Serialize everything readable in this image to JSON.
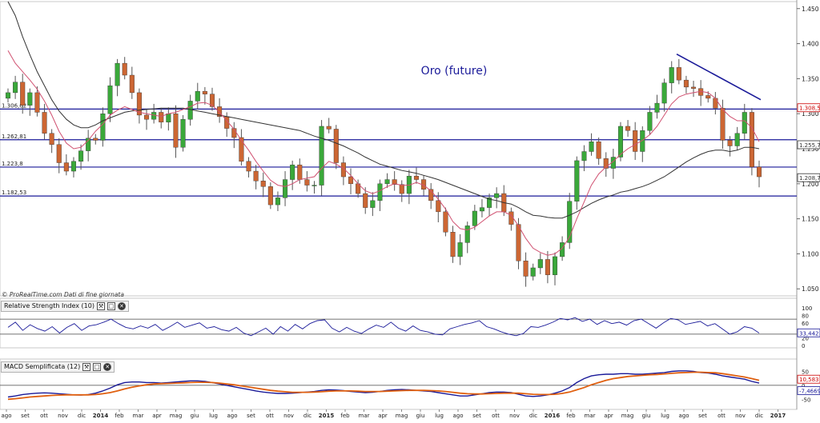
{
  "chart_data": [
    {
      "type": "candlestick",
      "title": "Oro (future)",
      "ylim": [
        1040,
        1460
      ],
      "y_ticks": [
        "1.450",
        "1.400",
        "1.350",
        "1.300",
        "1.250",
        "1.200",
        "1.150",
        "1.100",
        "1.050"
      ],
      "x_labels": [
        "ago",
        "set",
        "ott",
        "nov",
        "dic",
        "2014",
        "feb",
        "mar",
        "apr",
        "mag",
        "giu",
        "lug",
        "ago",
        "set",
        "ott",
        "nov",
        "dic",
        "2015",
        "feb",
        "mar",
        "apr",
        "mag",
        "giu",
        "lug",
        "ago",
        "set",
        "ott",
        "nov",
        "dic",
        "2016",
        "feb",
        "mar",
        "apr",
        "mag",
        "giu",
        "lug",
        "ago",
        "set",
        "ott",
        "nov",
        "dic",
        "2017"
      ],
      "close_path": [
        1330,
        1345,
        1312,
        1330,
        1302,
        1272,
        1256,
        1230,
        1218,
        1232,
        1247,
        1265,
        1262,
        1300,
        1340,
        1372,
        1355,
        1330,
        1298,
        1292,
        1302,
        1288,
        1300,
        1252,
        1292,
        1318,
        1332,
        1328,
        1310,
        1296,
        1279,
        1266,
        1232,
        1218,
        1204,
        1196,
        1170,
        1180,
        1206,
        1227,
        1206,
        1198,
        1198,
        1282,
        1278,
        1230,
        1210,
        1200,
        1186,
        1166,
        1176,
        1200,
        1206,
        1199,
        1186,
        1211,
        1206,
        1192,
        1176,
        1160,
        1131,
        1096,
        1116,
        1140,
        1161,
        1166,
        1180,
        1186,
        1160,
        1142,
        1090,
        1068,
        1080,
        1092,
        1070,
        1096,
        1116,
        1175,
        1233,
        1246,
        1260,
        1236,
        1222,
        1238,
        1282,
        1276,
        1246,
        1276,
        1302,
        1315,
        1344,
        1366,
        1348,
        1338,
        1336,
        1326,
        1322,
        1308,
        1262,
        1254,
        1272,
        1302,
        1224,
        1210
      ],
      "ma20_path": [
        1390,
        1372,
        1360,
        1348,
        1335,
        1318,
        1298,
        1275,
        1258,
        1250,
        1252,
        1262,
        1275,
        1285,
        1298,
        1305,
        1310,
        1306,
        1302,
        1300,
        1298,
        1296,
        1300,
        1302,
        1306,
        1310,
        1315,
        1316,
        1312,
        1302,
        1290,
        1278,
        1262,
        1248,
        1232,
        1218,
        1205,
        1198,
        1196,
        1200,
        1206,
        1208,
        1210,
        1222,
        1232,
        1228,
        1222,
        1212,
        1200,
        1190,
        1186,
        1190,
        1196,
        1200,
        1198,
        1198,
        1202,
        1198,
        1190,
        1178,
        1164,
        1146,
        1136,
        1134,
        1138,
        1146,
        1154,
        1160,
        1160,
        1155,
        1140,
        1122,
        1108,
        1102,
        1098,
        1100,
        1108,
        1124,
        1150,
        1174,
        1198,
        1214,
        1224,
        1232,
        1242,
        1250,
        1256,
        1262,
        1270,
        1282,
        1298,
        1314,
        1324,
        1328,
        1330,
        1332,
        1330,
        1322,
        1306,
        1296,
        1290,
        1290,
        1280,
        1260
      ],
      "ma100_path": [
        1470,
        1440,
        1410,
        1384,
        1360,
        1340,
        1320,
        1304,
        1292,
        1284,
        1280,
        1280,
        1284,
        1290,
        1294,
        1298,
        1302,
        1304,
        1305,
        1306,
        1307,
        1308,
        1308,
        1308,
        1308,
        1306,
        1304,
        1302,
        1300,
        1298,
        1296,
        1294,
        1292,
        1290,
        1288,
        1286,
        1284,
        1282,
        1280,
        1278,
        1276,
        1272,
        1268,
        1265,
        1262,
        1258,
        1254,
        1249,
        1244,
        1238,
        1233,
        1228,
        1225,
        1222,
        1219,
        1217,
        1215,
        1212,
        1209,
        1206,
        1202,
        1198,
        1194,
        1190,
        1186,
        1182,
        1178,
        1176,
        1173,
        1171,
        1166,
        1160,
        1155,
        1154,
        1152,
        1151,
        1151,
        1155,
        1160,
        1166,
        1172,
        1177,
        1181,
        1184,
        1188,
        1190,
        1193,
        1196,
        1200,
        1205,
        1210,
        1217,
        1224,
        1231,
        1237,
        1242,
        1246,
        1248,
        1248,
        1246,
        1248,
        1252,
        1252,
        1250
      ],
      "horizontal_levels": [
        {
          "label": "1.306,62",
          "value": 1306.62
        },
        {
          "label": "1.262,81",
          "value": 1262.81
        },
        {
          "label": "1.223,8",
          "value": 1223.8
        },
        {
          "label": "1.182,53",
          "value": 1182.53
        }
      ],
      "trendline": [
        1385,
        1320
      ],
      "price_tags": [
        {
          "label": "1.308,5",
          "value": 1308.5,
          "color": "#cc0000"
        },
        {
          "label": "1.255,7",
          "value": 1255.7,
          "color": "#333333"
        },
        {
          "label": "1.208,7",
          "value": 1208.7,
          "color": "#333333"
        }
      ],
      "colors": {
        "up": "#3aa83a",
        "down": "#cc6633",
        "ma20": "#d05070",
        "ma100": "#333333",
        "levels": "#1a1a99",
        "title": "#1a1a99"
      }
    },
    {
      "type": "line",
      "title": "Relative Strength Index (10)",
      "y_ticks": [
        "100",
        "80",
        "60",
        "40",
        "20",
        "0"
      ],
      "ylim": [
        0,
        100
      ],
      "reference_lines": [
        70,
        30
      ],
      "value_tag": "33,442",
      "values": [
        48,
        62,
        40,
        55,
        45,
        38,
        50,
        33,
        48,
        58,
        40,
        52,
        55,
        62,
        70,
        58,
        48,
        44,
        52,
        46,
        56,
        40,
        50,
        62,
        48,
        54,
        60,
        46,
        50,
        42,
        38,
        48,
        33,
        26,
        36,
        46,
        30,
        50,
        38,
        56,
        44,
        58,
        66,
        68,
        46,
        36,
        48,
        38,
        32,
        44,
        54,
        48,
        62,
        46,
        38,
        52,
        40,
        36,
        30,
        28,
        44,
        50,
        56,
        60,
        66,
        50,
        44,
        36,
        30,
        26,
        32,
        50,
        48,
        54,
        62,
        72,
        68,
        74,
        64,
        70,
        56,
        66,
        58,
        62,
        54,
        66,
        70,
        58,
        46,
        60,
        72,
        68,
        56,
        60,
        64,
        52,
        58,
        44,
        30,
        36,
        50,
        46,
        33
      ],
      "color": "#1a1a99"
    },
    {
      "type": "line",
      "title": "MACD Semplificata (12)",
      "y_ticks": [
        "50",
        "0",
        "-50"
      ],
      "ylim": [
        -72,
        60
      ],
      "value_tags": [
        {
          "label": "10,583",
          "color": "#cc0000"
        },
        {
          "label": "-7,4669",
          "color": "#1a1a99"
        }
      ],
      "series": [
        {
          "values": [
            -42,
            -38,
            -33,
            -30,
            -28,
            -27,
            -28,
            -30,
            -32,
            -34,
            -35,
            -33,
            -28,
            -20,
            -10,
            2,
            10,
            12,
            12,
            10,
            10,
            8,
            10,
            12,
            14,
            16,
            16,
            14,
            10,
            5,
            0,
            -5,
            -10,
            -15,
            -20,
            -24,
            -27,
            -29,
            -29,
            -28,
            -26,
            -24,
            -22,
            -18,
            -16,
            -17,
            -19,
            -22,
            -24,
            -26,
            -25,
            -22,
            -18,
            -16,
            -15,
            -16,
            -18,
            -20,
            -22,
            -26,
            -30,
            -34,
            -38,
            -38,
            -34,
            -30,
            -26,
            -24,
            -24,
            -26,
            -32,
            -38,
            -40,
            -38,
            -34,
            -28,
            -20,
            -8,
            10,
            24,
            34,
            38,
            40,
            40,
            42,
            42,
            40,
            40,
            42,
            44,
            46,
            50,
            52,
            52,
            50,
            46,
            44,
            40,
            34,
            30,
            26,
            22,
            14,
            8
          ],
          "color": "#1a1a99"
        },
        {
          "values": [
            -50,
            -48,
            -45,
            -42,
            -40,
            -38,
            -36,
            -35,
            -34,
            -34,
            -34,
            -34,
            -33,
            -30,
            -26,
            -20,
            -13,
            -7,
            -2,
            2,
            5,
            6,
            7,
            8,
            9,
            10,
            11,
            11,
            10,
            8,
            5,
            2,
            -2,
            -6,
            -10,
            -14,
            -18,
            -21,
            -23,
            -25,
            -25,
            -25,
            -24,
            -23,
            -21,
            -20,
            -20,
            -20,
            -21,
            -22,
            -22,
            -22,
            -21,
            -20,
            -19,
            -18,
            -18,
            -18,
            -19,
            -20,
            -22,
            -25,
            -28,
            -30,
            -31,
            -31,
            -30,
            -29,
            -28,
            -28,
            -28,
            -30,
            -32,
            -33,
            -33,
            -32,
            -29,
            -24,
            -16,
            -8,
            2,
            10,
            18,
            24,
            28,
            32,
            34,
            36,
            38,
            39,
            41,
            43,
            45,
            46,
            47,
            47,
            46,
            45,
            42,
            38,
            34,
            30,
            24,
            18
          ],
          "color": "#e06010"
        }
      ]
    }
  ],
  "ui": {
    "credit": "© ProRealTime.com  Dati di fine giornata",
    "rsi_header": "Relative Strength Index (10)",
    "macd_header": "MACD Semplificata (12)"
  }
}
